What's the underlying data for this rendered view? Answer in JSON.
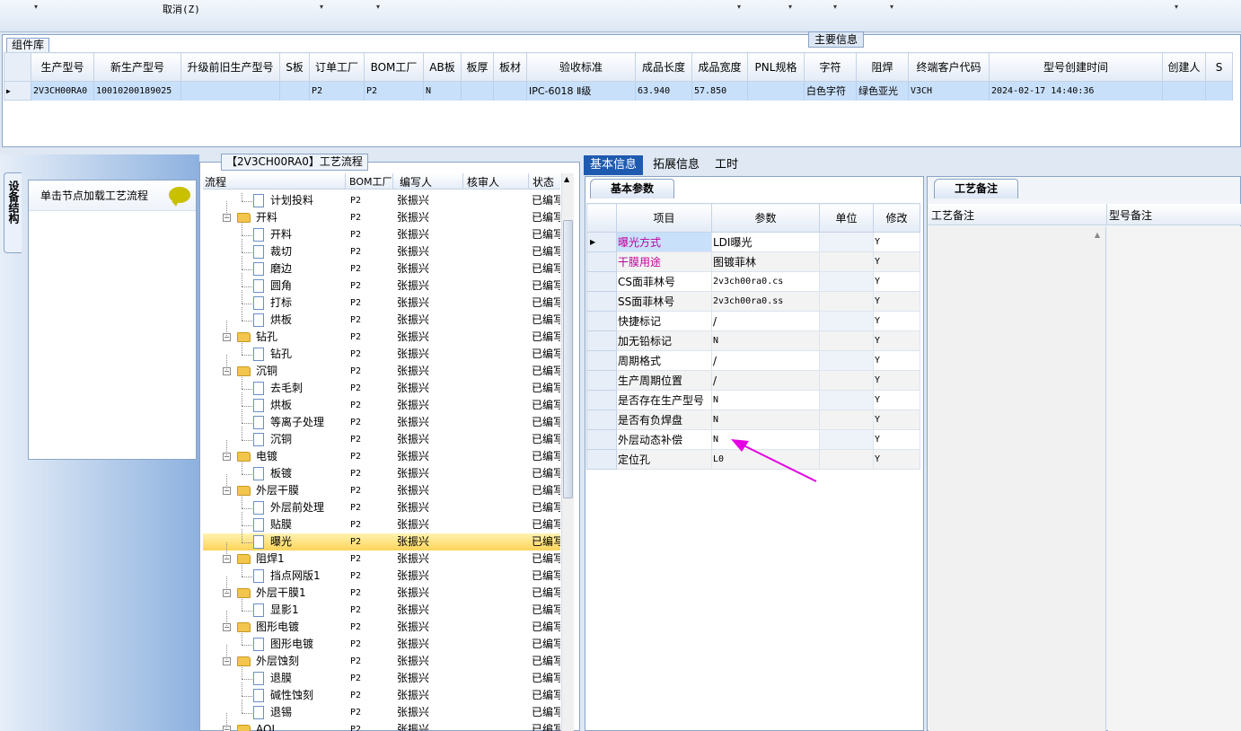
{
  "toolbar": {
    "cancel_label": "取消(Z)",
    "dropdown_glyph": "▾"
  },
  "top_group": {
    "caption": "组件库",
    "main_tab": "主要信息",
    "columns": [
      "生产型号",
      "新生产型号",
      "升级前旧生产型号",
      "S板",
      "订单工厂",
      "BOM工厂",
      "AB板",
      "板厚",
      "板材",
      "验收标准",
      "成品长度",
      "成品宽度",
      "PNL规格",
      "字符",
      "阻焊",
      "终端客户代码",
      "型号创建时间",
      "创建人",
      "S"
    ],
    "row": [
      "2V3CH00RA0",
      "10010200189025",
      "",
      "",
      "P2",
      "P2",
      "N",
      "",
      "",
      "IPC-6018 Ⅱ级",
      "63.940",
      "57.850",
      "",
      "白色字符",
      "绿色亚光",
      "V3CH",
      "2024-02-17 14:40:36",
      "",
      ""
    ]
  },
  "left_panel": {
    "side_tab": "设备结构",
    "hint": "单击节点加载工艺流程"
  },
  "tree": {
    "caption": "【2V3CH00RA0】工艺流程",
    "columns": [
      "流程",
      "BOM工厂",
      "编写人",
      "核审人",
      "状态"
    ],
    "rows": [
      {
        "level": 1,
        "type": "doc",
        "name": "计划投料",
        "bom": "P2",
        "writer": "张振兴",
        "status": "已编写"
      },
      {
        "level": 0,
        "type": "folder",
        "name": "开料",
        "bom": "P2",
        "writer": "张振兴",
        "status": "已编写"
      },
      {
        "level": 1,
        "type": "doc",
        "name": "开料",
        "bom": "P2",
        "writer": "张振兴",
        "status": "已编写"
      },
      {
        "level": 1,
        "type": "doc",
        "name": "裁切",
        "bom": "P2",
        "writer": "张振兴",
        "status": "已编写"
      },
      {
        "level": 1,
        "type": "doc",
        "name": "磨边",
        "bom": "P2",
        "writer": "张振兴",
        "status": "已编写"
      },
      {
        "level": 1,
        "type": "doc",
        "name": "圆角",
        "bom": "P2",
        "writer": "张振兴",
        "status": "已编写"
      },
      {
        "level": 1,
        "type": "doc",
        "name": "打标",
        "bom": "P2",
        "writer": "张振兴",
        "status": "已编写"
      },
      {
        "level": 1,
        "type": "doc",
        "name": "烘板",
        "bom": "P2",
        "writer": "张振兴",
        "status": "已编写"
      },
      {
        "level": 0,
        "type": "folder",
        "name": "钻孔",
        "bom": "P2",
        "writer": "张振兴",
        "status": "已编写"
      },
      {
        "level": 1,
        "type": "doc",
        "name": "钻孔",
        "bom": "P2",
        "writer": "张振兴",
        "status": "已编写"
      },
      {
        "level": 0,
        "type": "folder",
        "name": "沉铜",
        "bom": "P2",
        "writer": "张振兴",
        "status": "已编写"
      },
      {
        "level": 1,
        "type": "doc",
        "name": "去毛刺",
        "bom": "P2",
        "writer": "张振兴",
        "status": "已编写"
      },
      {
        "level": 1,
        "type": "doc",
        "name": "烘板",
        "bom": "P2",
        "writer": "张振兴",
        "status": "已编写"
      },
      {
        "level": 1,
        "type": "doc",
        "name": "等离子处理",
        "bom": "P2",
        "writer": "张振兴",
        "status": "已编写"
      },
      {
        "level": 1,
        "type": "doc",
        "name": "沉铜",
        "bom": "P2",
        "writer": "张振兴",
        "status": "已编写"
      },
      {
        "level": 0,
        "type": "folder",
        "name": "电镀",
        "bom": "P2",
        "writer": "张振兴",
        "status": "已编写"
      },
      {
        "level": 1,
        "type": "doc",
        "name": "板镀",
        "bom": "P2",
        "writer": "张振兴",
        "status": "已编写"
      },
      {
        "level": 0,
        "type": "folder",
        "name": "外层干膜",
        "bom": "P2",
        "writer": "张振兴",
        "status": "已编写"
      },
      {
        "level": 1,
        "type": "doc",
        "name": "外层前处理",
        "bom": "P2",
        "writer": "张振兴",
        "status": "已编写"
      },
      {
        "level": 1,
        "type": "doc",
        "name": "贴膜",
        "bom": "P2",
        "writer": "张振兴",
        "status": "已编写"
      },
      {
        "level": 1,
        "type": "doc",
        "name": "曝光",
        "bom": "P2",
        "writer": "张振兴",
        "status": "已编写",
        "selected": true
      },
      {
        "level": 0,
        "type": "folder",
        "name": "阻焊1",
        "bom": "P2",
        "writer": "张振兴",
        "status": "已编写"
      },
      {
        "level": 1,
        "type": "doc",
        "name": "挡点网版1",
        "bom": "P2",
        "writer": "张振兴",
        "status": "已编写"
      },
      {
        "level": 0,
        "type": "folder",
        "name": "外层干膜1",
        "bom": "P2",
        "writer": "张振兴",
        "status": "已编写"
      },
      {
        "level": 1,
        "type": "doc",
        "name": "显影1",
        "bom": "P2",
        "writer": "张振兴",
        "status": "已编写"
      },
      {
        "level": 0,
        "type": "folder",
        "name": "图形电镀",
        "bom": "P2",
        "writer": "张振兴",
        "status": "已编写"
      },
      {
        "level": 1,
        "type": "doc",
        "name": "图形电镀",
        "bom": "P2",
        "writer": "张振兴",
        "status": "已编写"
      },
      {
        "level": 0,
        "type": "folder",
        "name": "外层蚀刻",
        "bom": "P2",
        "writer": "张振兴",
        "status": "已编写"
      },
      {
        "level": 1,
        "type": "doc",
        "name": "退膜",
        "bom": "P2",
        "writer": "张振兴",
        "status": "已编写"
      },
      {
        "level": 1,
        "type": "doc",
        "name": "碱性蚀刻",
        "bom": "P2",
        "writer": "张振兴",
        "status": "已编写"
      },
      {
        "level": 1,
        "type": "doc",
        "name": "退锡",
        "bom": "P2",
        "writer": "张振兴",
        "status": "已编写"
      },
      {
        "level": 0,
        "type": "folder",
        "name": "AOI",
        "bom": "P2",
        "writer": "张振兴",
        "status": "已编写"
      }
    ]
  },
  "right_tabs": [
    "基本信息",
    "拓展信息",
    "工时"
  ],
  "params": {
    "tab": "基本参数",
    "columns": [
      "项目",
      "参数",
      "单位",
      "修改"
    ],
    "rows": [
      {
        "item": "曝光方式",
        "value": "LDI曝光",
        "unit": "",
        "edit": "Y",
        "highlight": true,
        "current": true
      },
      {
        "item": "干膜用途",
        "value": "图镀菲林",
        "unit": "",
        "edit": "Y",
        "highlight": true
      },
      {
        "item": "CS面菲林号",
        "value": "2v3ch00ra0.cs",
        "unit": "",
        "edit": "Y",
        "mono": true
      },
      {
        "item": "SS面菲林号",
        "value": "2v3ch00ra0.ss",
        "unit": "",
        "edit": "Y",
        "mono": true
      },
      {
        "item": "快捷标记",
        "value": "/",
        "unit": "",
        "edit": "Y"
      },
      {
        "item": "加无铅标记",
        "value": "N",
        "unit": "",
        "edit": "Y",
        "mono": true
      },
      {
        "item": "周期格式",
        "value": "/",
        "unit": "",
        "edit": "Y"
      },
      {
        "item": "生产周期位置",
        "value": "/",
        "unit": "",
        "edit": "Y"
      },
      {
        "item": "是否存在生产型号",
        "value": "N",
        "unit": "",
        "edit": "Y",
        "mono": true
      },
      {
        "item": "是否有负焊盘",
        "value": "N",
        "unit": "",
        "edit": "Y",
        "mono": true
      },
      {
        "item": "外层动态补偿",
        "value": "N",
        "unit": "",
        "edit": "Y",
        "mono": true
      },
      {
        "item": "定位孔",
        "value": "L0",
        "unit": "",
        "edit": "Y",
        "mono": true
      }
    ]
  },
  "remarks": {
    "tab": "工艺备注",
    "col1": "工艺备注",
    "col2": "型号备注"
  },
  "colors": {
    "accent": "#1e5bb0",
    "highlight_text": "#c0009a",
    "arrow": "#e600e6",
    "selection": "#fdd45a"
  }
}
